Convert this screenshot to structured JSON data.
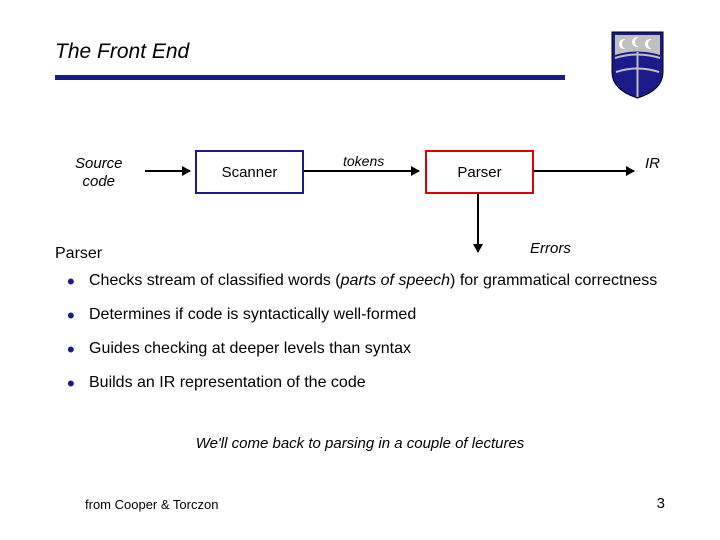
{
  "title": "The Front End",
  "diagram": {
    "source": "Source code",
    "scanner": "Scanner",
    "tokens": "tokens",
    "parser": "Parser",
    "ir": "IR",
    "errors": "Errors"
  },
  "section_heading": "Parser",
  "bullets": [
    {
      "pre": "Checks stream of classified words (",
      "emph": "parts of speech",
      "post": ") for grammatical correctness"
    },
    {
      "pre": "Determines if code is syntactically well-formed",
      "emph": "",
      "post": ""
    },
    {
      "pre": "Guides checking at deeper levels than syntax",
      "emph": "",
      "post": ""
    },
    {
      "pre": "Builds an ",
      "emph": "",
      "post": "IR representation of the code"
    }
  ],
  "closing": "We'll come back to parsing in a couple of lectures",
  "footer_left": "from Cooper & Torczon",
  "page_number": "3"
}
